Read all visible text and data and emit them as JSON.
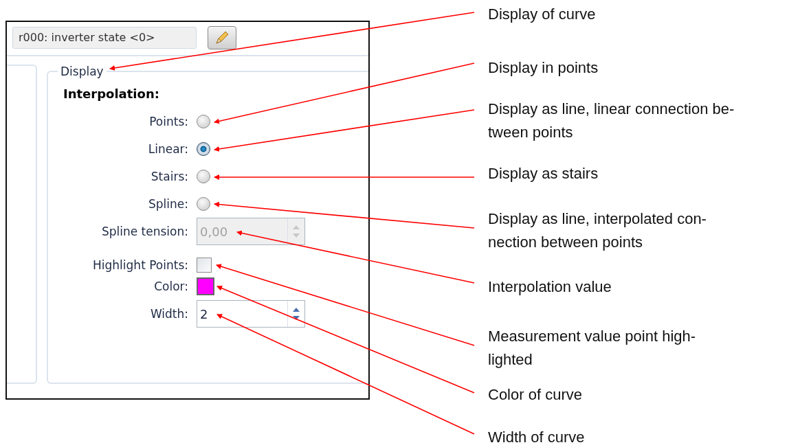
{
  "top_field": {
    "value": "r000: inverter state <0>"
  },
  "display_group": {
    "title": "Display",
    "interpolation_heading": "Interpolation:",
    "options": [
      {
        "label": "Points:",
        "selected": false
      },
      {
        "label": "Linear:",
        "selected": true
      },
      {
        "label": "Stairs:",
        "selected": false
      },
      {
        "label": "Spline:",
        "selected": false
      }
    ],
    "spline_tension": {
      "label": "Spline tension:",
      "value": "0,00",
      "disabled": true
    },
    "highlight_points": {
      "label": "Highlight Points:",
      "checked": false
    },
    "curve_color": {
      "label": "Color:",
      "color": "#ff00ff"
    },
    "width": {
      "label": "Width:",
      "value": "2",
      "disabled": false
    }
  },
  "callouts": [
    {
      "lines": [
        "Display of curve"
      ]
    },
    {
      "lines": [
        "Display in points"
      ]
    },
    {
      "lines": [
        "Display as line, linear connection be-",
        "tween points"
      ]
    },
    {
      "lines": [
        "Display as stairs"
      ]
    },
    {
      "lines": [
        "Display as line, interpolated con-",
        "nection between points"
      ]
    },
    {
      "lines": [
        "Interpolation value"
      ]
    },
    {
      "lines": [
        "Measurement value point high-",
        "lighted"
      ]
    },
    {
      "lines": [
        "Color of curve"
      ]
    },
    {
      "lines": [
        "Width of curve"
      ]
    }
  ]
}
